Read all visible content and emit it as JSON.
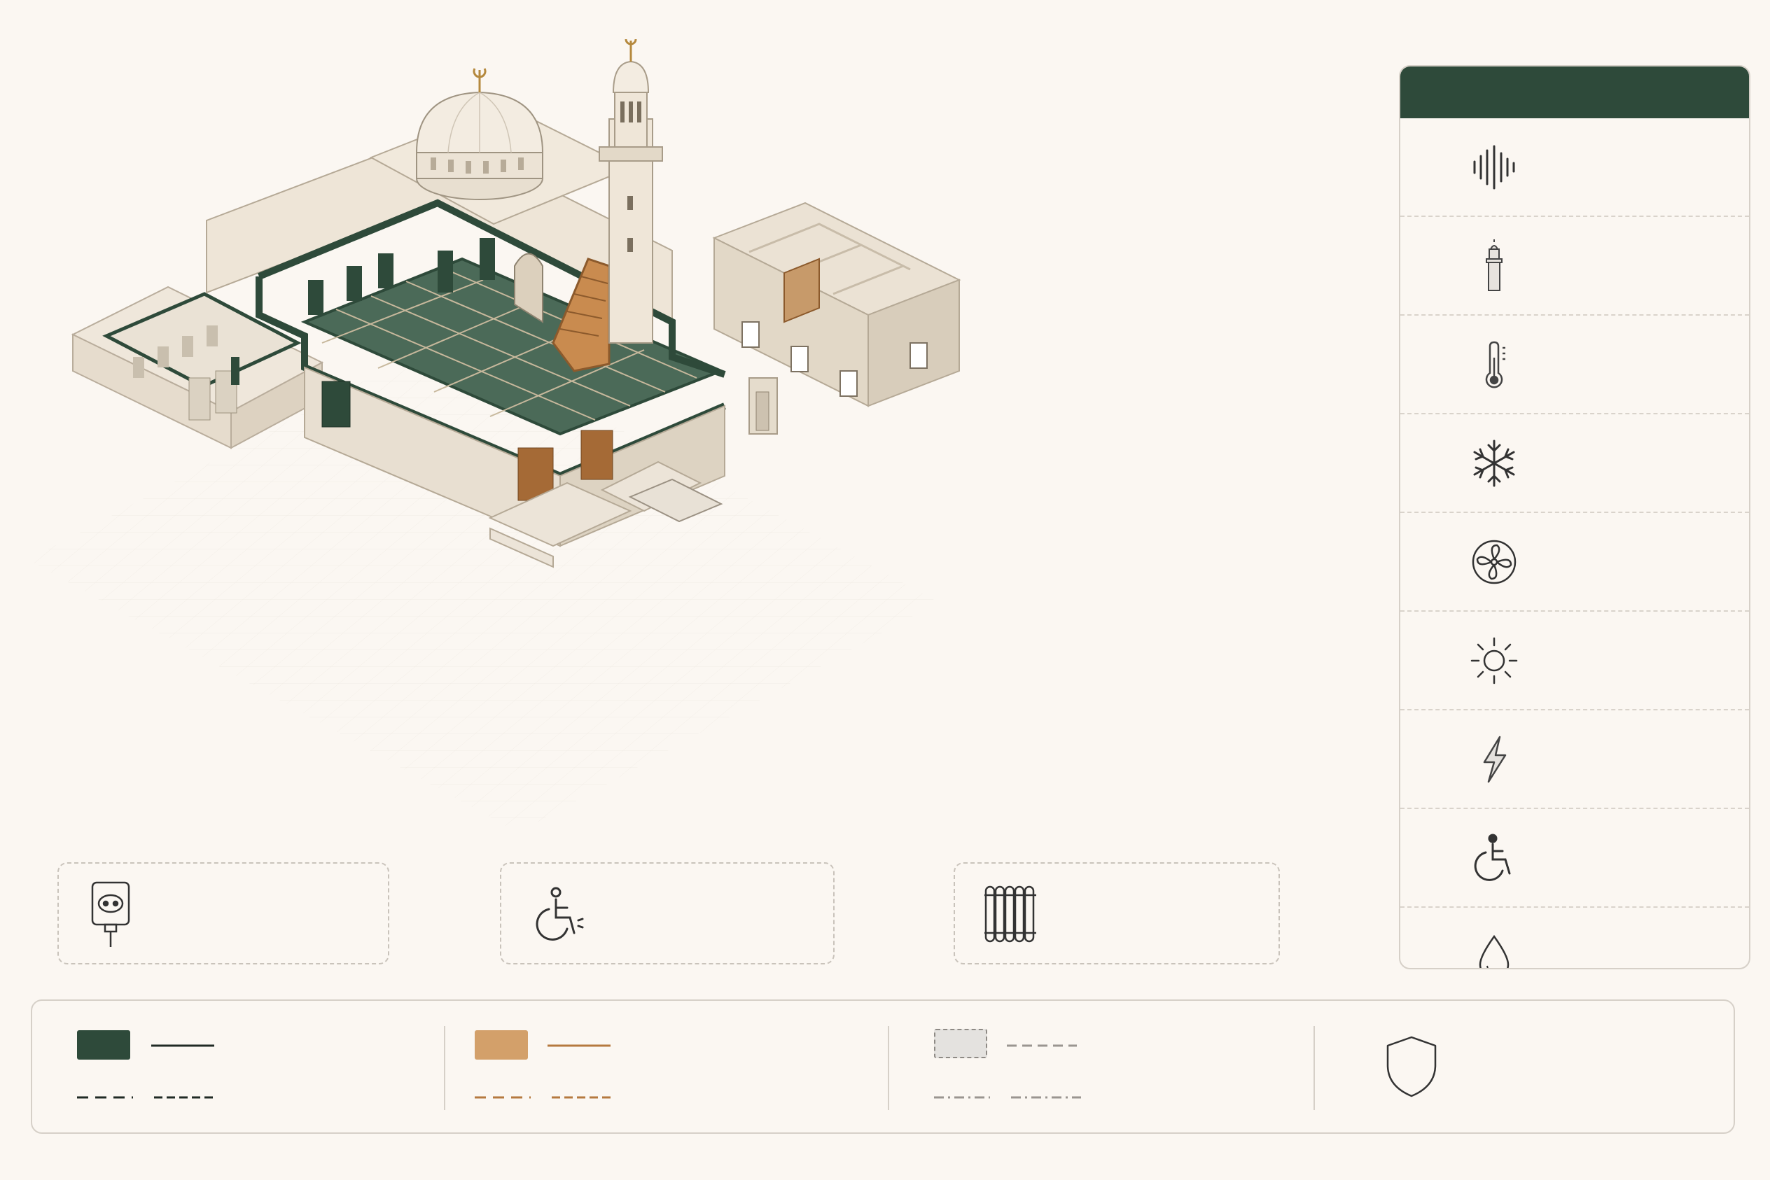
{
  "colors": {
    "primary_green": "#2e4a3a",
    "wood": "#d3a06a",
    "stone": "#ece3d6",
    "background": "#fbf7f2",
    "line_gray": "#a8a29b"
  },
  "sidebar": {
    "items": [
      {
        "icon": "acoustics-icon"
      },
      {
        "icon": "minaret-icon"
      },
      {
        "icon": "thermometer-icon"
      },
      {
        "icon": "snowflake-icon"
      },
      {
        "icon": "fan-icon"
      },
      {
        "icon": "sun-icon"
      },
      {
        "icon": "lightning-icon"
      },
      {
        "icon": "wheelchair-icon"
      },
      {
        "icon": "water-drop-icon"
      }
    ]
  },
  "cards": [
    {
      "icon": "power-outlet-icon"
    },
    {
      "icon": "wheelchair-icon"
    },
    {
      "icon": "radiator-icon"
    }
  ],
  "legend": {
    "groups": [
      {
        "swatch_color": "#2e4a3a",
        "line_style": "solid"
      },
      {
        "swatch_color": "#d3a06a",
        "line_style": "solid"
      },
      {
        "swatch_color": "#e4e2df",
        "line_style": "dashed"
      }
    ],
    "badge_icon": "shield-icon"
  }
}
